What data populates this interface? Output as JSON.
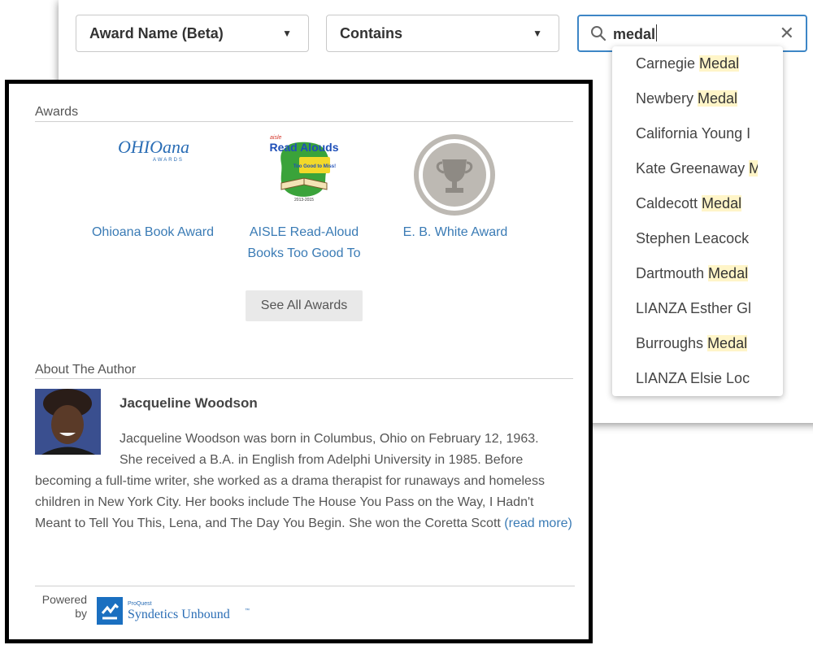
{
  "filters": {
    "field_select": "Award Name (Beta)",
    "operator_select": "Contains",
    "search": {
      "query": "medal",
      "clear_icon": "x-icon",
      "search_icon": "magnifier-icon"
    }
  },
  "suggestions": [
    {
      "prefix": "Carnegie ",
      "match": "Medal"
    },
    {
      "prefix": "Newbery ",
      "match": "Medal"
    },
    {
      "prefix": "California Young I",
      "match": ""
    },
    {
      "prefix": "Kate Greenaway ",
      "match": "M"
    },
    {
      "prefix": "Caldecott ",
      "match": "Medal"
    },
    {
      "prefix": "Stephen Leacock",
      "match": ""
    },
    {
      "prefix": "Dartmouth ",
      "match": "Medal"
    },
    {
      "prefix": "LIANZA Esther Gl",
      "match": ""
    },
    {
      "prefix": "Burroughs ",
      "match": "Medal"
    },
    {
      "prefix": "LIANZA Elsie Loc",
      "match": ""
    }
  ],
  "awards_section": {
    "title": "Awards",
    "items": [
      {
        "name": "Ohioana Book Award",
        "logo_text": "OHIOana",
        "logo_sub": "AWARDS"
      },
      {
        "name_line1": "AISLE Read-Aloud",
        "name_line2": "Books Too Good To",
        "logo_text_1": "Read Alouds",
        "logo_text_2": "Too Good to Miss!",
        "logo_small": "aisle",
        "logo_years": "2013-2015"
      },
      {
        "name": "E. B. White Award",
        "icon": "trophy-icon"
      }
    ],
    "see_all": "See All Awards"
  },
  "author_section": {
    "title": "About The Author",
    "name": "Jacqueline Woodson",
    "bio_line1": "Jacqueline Woodson was born in Columbus, Ohio on February 12, 1963.",
    "bio_line2": "She received a B.A. in English from Adelphi University in 1985. Before",
    "bio_rest": "becoming a full-time writer, she worked as a drama therapist for runaways and homeless children in New York City. Her books include The House You Pass on the Way, I Hadn't Meant to Tell You This, Lena, and The Day You Begin. She won the Coretta Scott ",
    "read_more": "(read more)"
  },
  "footer": {
    "powered_line1": "Powered",
    "powered_line2": "by",
    "brand_small": "ProQuest",
    "brand": "Syndetics Unbound",
    "brand_mark": "™"
  },
  "colors": {
    "accent": "#3d86c6",
    "link": "#3a7bb5",
    "highlight": "#fff5c8",
    "logo_blue": "#2a6db5"
  }
}
